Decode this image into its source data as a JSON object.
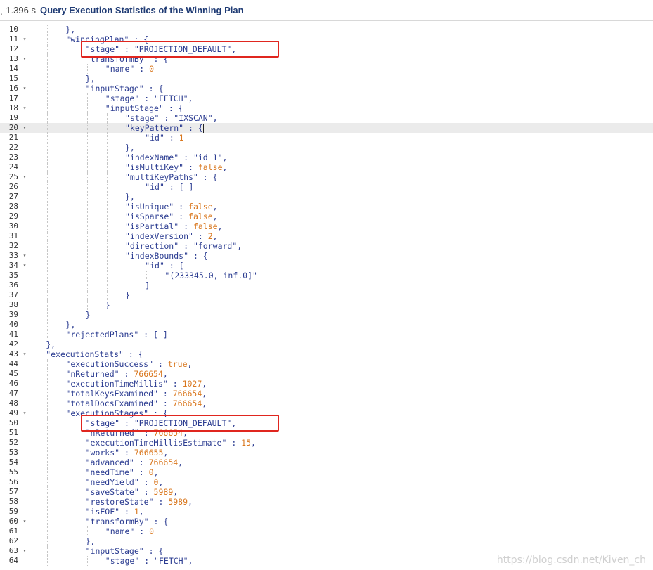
{
  "header": {
    "prefix": "ˌ",
    "elapsed": "1.396 s",
    "title": "Query Execution Statistics of the Winning Plan"
  },
  "editor": {
    "first_line_number": 10,
    "active_line": 20,
    "lines": [
      {
        "n": 10,
        "fold": false,
        "indent": 2,
        "tokens": [
          [
            "p",
            "},"
          ]
        ]
      },
      {
        "n": 11,
        "fold": true,
        "indent": 2,
        "tokens": [
          [
            "k",
            "\"winningPlan\""
          ],
          [
            "p",
            " : {"
          ]
        ]
      },
      {
        "n": 12,
        "fold": false,
        "indent": 3,
        "tokens": [
          [
            "k",
            "\"stage\""
          ],
          [
            "p",
            " : "
          ],
          [
            "s",
            "\"PROJECTION_DEFAULT\""
          ],
          [
            "p",
            ","
          ]
        ]
      },
      {
        "n": 13,
        "fold": true,
        "indent": 3,
        "tokens": [
          [
            "k",
            "\"transformBy\""
          ],
          [
            "p",
            " : {"
          ]
        ]
      },
      {
        "n": 14,
        "fold": false,
        "indent": 4,
        "tokens": [
          [
            "k",
            "\"name\""
          ],
          [
            "p",
            " : "
          ],
          [
            "n",
            "0"
          ]
        ]
      },
      {
        "n": 15,
        "fold": false,
        "indent": 3,
        "tokens": [
          [
            "p",
            "},"
          ]
        ]
      },
      {
        "n": 16,
        "fold": true,
        "indent": 3,
        "tokens": [
          [
            "k",
            "\"inputStage\""
          ],
          [
            "p",
            " : {"
          ]
        ]
      },
      {
        "n": 17,
        "fold": false,
        "indent": 4,
        "tokens": [
          [
            "k",
            "\"stage\""
          ],
          [
            "p",
            " : "
          ],
          [
            "s",
            "\"FETCH\""
          ],
          [
            "p",
            ","
          ]
        ]
      },
      {
        "n": 18,
        "fold": true,
        "indent": 4,
        "tokens": [
          [
            "k",
            "\"inputStage\""
          ],
          [
            "p",
            " : {"
          ]
        ]
      },
      {
        "n": 19,
        "fold": false,
        "indent": 5,
        "tokens": [
          [
            "k",
            "\"stage\""
          ],
          [
            "p",
            " : "
          ],
          [
            "s",
            "\"IXSCAN\""
          ],
          [
            "p",
            ","
          ]
        ]
      },
      {
        "n": 20,
        "fold": true,
        "indent": 5,
        "caret": true,
        "tokens": [
          [
            "k",
            "\"keyPattern\""
          ],
          [
            "p",
            " : {"
          ]
        ]
      },
      {
        "n": 21,
        "fold": false,
        "indent": 6,
        "tokens": [
          [
            "k",
            "\"id\""
          ],
          [
            "p",
            " : "
          ],
          [
            "n",
            "1"
          ]
        ]
      },
      {
        "n": 22,
        "fold": false,
        "indent": 5,
        "tokens": [
          [
            "p",
            "},"
          ]
        ]
      },
      {
        "n": 23,
        "fold": false,
        "indent": 5,
        "tokens": [
          [
            "k",
            "\"indexName\""
          ],
          [
            "p",
            " : "
          ],
          [
            "s",
            "\"id_1\""
          ],
          [
            "p",
            ","
          ]
        ]
      },
      {
        "n": 24,
        "fold": false,
        "indent": 5,
        "tokens": [
          [
            "k",
            "\"isMultiKey\""
          ],
          [
            "p",
            " : "
          ],
          [
            "b",
            "false"
          ],
          [
            "p",
            ","
          ]
        ]
      },
      {
        "n": 25,
        "fold": true,
        "indent": 5,
        "tokens": [
          [
            "k",
            "\"multiKeyPaths\""
          ],
          [
            "p",
            " : {"
          ]
        ]
      },
      {
        "n": 26,
        "fold": false,
        "indent": 6,
        "tokens": [
          [
            "k",
            "\"id\""
          ],
          [
            "p",
            " : [ ]"
          ]
        ]
      },
      {
        "n": 27,
        "fold": false,
        "indent": 5,
        "tokens": [
          [
            "p",
            "},"
          ]
        ]
      },
      {
        "n": 28,
        "fold": false,
        "indent": 5,
        "tokens": [
          [
            "k",
            "\"isUnique\""
          ],
          [
            "p",
            " : "
          ],
          [
            "b",
            "false"
          ],
          [
            "p",
            ","
          ]
        ]
      },
      {
        "n": 29,
        "fold": false,
        "indent": 5,
        "tokens": [
          [
            "k",
            "\"isSparse\""
          ],
          [
            "p",
            " : "
          ],
          [
            "b",
            "false"
          ],
          [
            "p",
            ","
          ]
        ]
      },
      {
        "n": 30,
        "fold": false,
        "indent": 5,
        "tokens": [
          [
            "k",
            "\"isPartial\""
          ],
          [
            "p",
            " : "
          ],
          [
            "b",
            "false"
          ],
          [
            "p",
            ","
          ]
        ]
      },
      {
        "n": 31,
        "fold": false,
        "indent": 5,
        "tokens": [
          [
            "k",
            "\"indexVersion\""
          ],
          [
            "p",
            " : "
          ],
          [
            "n",
            "2"
          ],
          [
            "p",
            ","
          ]
        ]
      },
      {
        "n": 32,
        "fold": false,
        "indent": 5,
        "tokens": [
          [
            "k",
            "\"direction\""
          ],
          [
            "p",
            " : "
          ],
          [
            "s",
            "\"forward\""
          ],
          [
            "p",
            ","
          ]
        ]
      },
      {
        "n": 33,
        "fold": true,
        "indent": 5,
        "tokens": [
          [
            "k",
            "\"indexBounds\""
          ],
          [
            "p",
            " : {"
          ]
        ]
      },
      {
        "n": 34,
        "fold": true,
        "indent": 6,
        "tokens": [
          [
            "k",
            "\"id\""
          ],
          [
            "p",
            " : ["
          ]
        ]
      },
      {
        "n": 35,
        "fold": false,
        "indent": 7,
        "tokens": [
          [
            "s",
            "\"(233345.0, inf.0]\""
          ]
        ]
      },
      {
        "n": 36,
        "fold": false,
        "indent": 6,
        "tokens": [
          [
            "p",
            "]"
          ]
        ]
      },
      {
        "n": 37,
        "fold": false,
        "indent": 5,
        "tokens": [
          [
            "p",
            "}"
          ]
        ]
      },
      {
        "n": 38,
        "fold": false,
        "indent": 4,
        "tokens": [
          [
            "p",
            "}"
          ]
        ]
      },
      {
        "n": 39,
        "fold": false,
        "indent": 3,
        "tokens": [
          [
            "p",
            "}"
          ]
        ]
      },
      {
        "n": 40,
        "fold": false,
        "indent": 2,
        "tokens": [
          [
            "p",
            "},"
          ]
        ]
      },
      {
        "n": 41,
        "fold": false,
        "indent": 2,
        "tokens": [
          [
            "k",
            "\"rejectedPlans\""
          ],
          [
            "p",
            " : [ ]"
          ]
        ]
      },
      {
        "n": 42,
        "fold": false,
        "indent": 1,
        "tokens": [
          [
            "p",
            "},"
          ]
        ]
      },
      {
        "n": 43,
        "fold": true,
        "indent": 1,
        "tokens": [
          [
            "k",
            "\"executionStats\""
          ],
          [
            "p",
            " : {"
          ]
        ]
      },
      {
        "n": 44,
        "fold": false,
        "indent": 2,
        "tokens": [
          [
            "k",
            "\"executionSuccess\""
          ],
          [
            "p",
            " : "
          ],
          [
            "b",
            "true"
          ],
          [
            "p",
            ","
          ]
        ]
      },
      {
        "n": 45,
        "fold": false,
        "indent": 2,
        "tokens": [
          [
            "k",
            "\"nReturned\""
          ],
          [
            "p",
            " : "
          ],
          [
            "n",
            "766654"
          ],
          [
            "p",
            ","
          ]
        ]
      },
      {
        "n": 46,
        "fold": false,
        "indent": 2,
        "tokens": [
          [
            "k",
            "\"executionTimeMillis\""
          ],
          [
            "p",
            " : "
          ],
          [
            "n",
            "1027"
          ],
          [
            "p",
            ","
          ]
        ]
      },
      {
        "n": 47,
        "fold": false,
        "indent": 2,
        "tokens": [
          [
            "k",
            "\"totalKeysExamined\""
          ],
          [
            "p",
            " : "
          ],
          [
            "n",
            "766654"
          ],
          [
            "p",
            ","
          ]
        ]
      },
      {
        "n": 48,
        "fold": false,
        "indent": 2,
        "tokens": [
          [
            "k",
            "\"totalDocsExamined\""
          ],
          [
            "p",
            " : "
          ],
          [
            "n",
            "766654"
          ],
          [
            "p",
            ","
          ]
        ]
      },
      {
        "n": 49,
        "fold": true,
        "indent": 2,
        "tokens": [
          [
            "k",
            "\"executionStages\""
          ],
          [
            "p",
            " : {"
          ]
        ]
      },
      {
        "n": 50,
        "fold": false,
        "indent": 3,
        "tokens": [
          [
            "k",
            "\"stage\""
          ],
          [
            "p",
            " : "
          ],
          [
            "s",
            "\"PROJECTION_DEFAULT\""
          ],
          [
            "p",
            ","
          ]
        ]
      },
      {
        "n": 51,
        "fold": false,
        "indent": 3,
        "tokens": [
          [
            "k",
            "\"nReturned\""
          ],
          [
            "p",
            " : "
          ],
          [
            "n",
            "766654"
          ],
          [
            "p",
            ","
          ]
        ]
      },
      {
        "n": 52,
        "fold": false,
        "indent": 3,
        "tokens": [
          [
            "k",
            "\"executionTimeMillisEstimate\""
          ],
          [
            "p",
            " : "
          ],
          [
            "n",
            "15"
          ],
          [
            "p",
            ","
          ]
        ]
      },
      {
        "n": 53,
        "fold": false,
        "indent": 3,
        "tokens": [
          [
            "k",
            "\"works\""
          ],
          [
            "p",
            " : "
          ],
          [
            "n",
            "766655"
          ],
          [
            "p",
            ","
          ]
        ]
      },
      {
        "n": 54,
        "fold": false,
        "indent": 3,
        "tokens": [
          [
            "k",
            "\"advanced\""
          ],
          [
            "p",
            " : "
          ],
          [
            "n",
            "766654"
          ],
          [
            "p",
            ","
          ]
        ]
      },
      {
        "n": 55,
        "fold": false,
        "indent": 3,
        "tokens": [
          [
            "k",
            "\"needTime\""
          ],
          [
            "p",
            " : "
          ],
          [
            "n",
            "0"
          ],
          [
            "p",
            ","
          ]
        ]
      },
      {
        "n": 56,
        "fold": false,
        "indent": 3,
        "tokens": [
          [
            "k",
            "\"needYield\""
          ],
          [
            "p",
            " : "
          ],
          [
            "n",
            "0"
          ],
          [
            "p",
            ","
          ]
        ]
      },
      {
        "n": 57,
        "fold": false,
        "indent": 3,
        "tokens": [
          [
            "k",
            "\"saveState\""
          ],
          [
            "p",
            " : "
          ],
          [
            "n",
            "5989"
          ],
          [
            "p",
            ","
          ]
        ]
      },
      {
        "n": 58,
        "fold": false,
        "indent": 3,
        "tokens": [
          [
            "k",
            "\"restoreState\""
          ],
          [
            "p",
            " : "
          ],
          [
            "n",
            "5989"
          ],
          [
            "p",
            ","
          ]
        ]
      },
      {
        "n": 59,
        "fold": false,
        "indent": 3,
        "tokens": [
          [
            "k",
            "\"isEOF\""
          ],
          [
            "p",
            " : "
          ],
          [
            "n",
            "1"
          ],
          [
            "p",
            ","
          ]
        ]
      },
      {
        "n": 60,
        "fold": true,
        "indent": 3,
        "tokens": [
          [
            "k",
            "\"transformBy\""
          ],
          [
            "p",
            " : {"
          ]
        ]
      },
      {
        "n": 61,
        "fold": false,
        "indent": 4,
        "tokens": [
          [
            "k",
            "\"name\""
          ],
          [
            "p",
            " : "
          ],
          [
            "n",
            "0"
          ]
        ]
      },
      {
        "n": 62,
        "fold": false,
        "indent": 3,
        "tokens": [
          [
            "p",
            "},"
          ]
        ]
      },
      {
        "n": 63,
        "fold": true,
        "indent": 3,
        "tokens": [
          [
            "k",
            "\"inputStage\""
          ],
          [
            "p",
            " : {"
          ]
        ]
      },
      {
        "n": 64,
        "fold": false,
        "indent": 4,
        "tokens": [
          [
            "k",
            "\"stage\""
          ],
          [
            "p",
            " : "
          ],
          [
            "s",
            "\"FETCH\""
          ],
          [
            "p",
            ","
          ]
        ]
      }
    ]
  },
  "highlights": [
    {
      "line": 12,
      "label": "winning-plan-stage"
    },
    {
      "line": 50,
      "label": "execution-stages-stage"
    }
  ],
  "watermark": "https://blog.csdn.net/Kiven_ch",
  "colors": {
    "key": "#2b3c91",
    "number": "#d9771e",
    "title": "#1f3b74",
    "highlight_box": "#e0261f",
    "active_line": "#ebebeb"
  }
}
